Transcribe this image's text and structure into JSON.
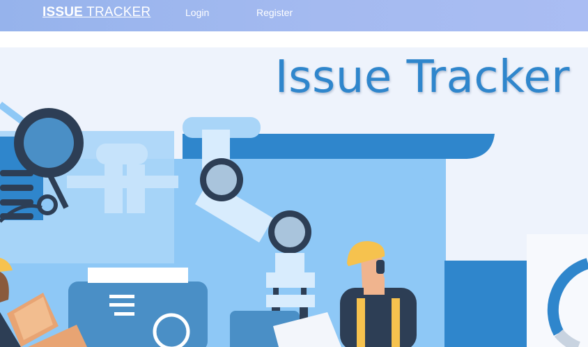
{
  "navbar": {
    "brand_bold": "ISSUE",
    "brand_rest": " TRACKER",
    "links": [
      {
        "label": "Login"
      },
      {
        "label": "Register"
      }
    ]
  },
  "hero": {
    "title": "Issue Tracker",
    "illustration": "factory-robot-arm-workers",
    "colors": {
      "background": "#eef3fc",
      "primary_blue": "#2f86cc",
      "light_blue": "#8ec8f6",
      "dark_navy": "#2d3e55",
      "hardhat_yellow": "#f6c24e"
    }
  }
}
